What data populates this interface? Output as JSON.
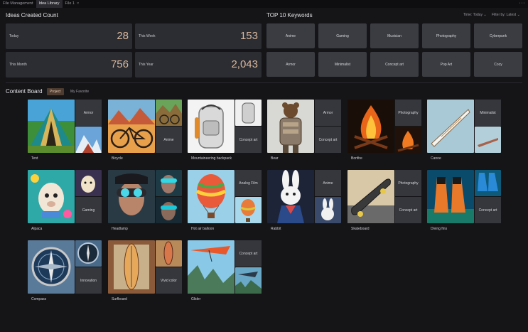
{
  "tabs": [
    {
      "label": "File Management",
      "active": false
    },
    {
      "label": "Idea Library",
      "active": true
    },
    {
      "label": "File 1",
      "active": false,
      "close": "×"
    }
  ],
  "window_menu": "···",
  "ideas": {
    "title": "Ideas Created Count",
    "stats": [
      {
        "label": "Today",
        "value": "28"
      },
      {
        "label": "This Week",
        "value": "153"
      },
      {
        "label": "This Month",
        "value": "756"
      },
      {
        "label": "This Year",
        "value": "2,043"
      }
    ]
  },
  "keywords": {
    "title": "TOP 10 Keywords",
    "time_filter": "Time: Today",
    "sort_filter": "Filter by: Latest",
    "chevron": "⌄",
    "items": [
      "Anime",
      "Gaming",
      "Musician",
      "Photography",
      "Cyberpunk",
      "Armor",
      "Minimalist",
      "Concept art",
      "Pop Art",
      "Cozy"
    ]
  },
  "content_board": {
    "title": "Content Board",
    "tabs": [
      {
        "label": "Project",
        "active": true
      },
      {
        "label": "My Favorite",
        "active": false
      }
    ],
    "cards": [
      {
        "name": "Tent",
        "top_label": "Armor",
        "bottom_label": ""
      },
      {
        "name": "Bicycle",
        "top_label": "",
        "bottom_label": "Anime"
      },
      {
        "name": "Mountaineering backpack",
        "top_label": "",
        "bottom_label": "Concept art"
      },
      {
        "name": "Bear",
        "top_label": "Armor",
        "bottom_label": "Concept art"
      },
      {
        "name": "Bonfire",
        "top_label": "Photography",
        "bottom_label": ""
      },
      {
        "name": "Canoe",
        "top_label": "Minimalist",
        "bottom_label": ""
      },
      {
        "name": "Alpaca",
        "top_label": "",
        "bottom_label": "Gaming"
      },
      {
        "name": "Headlamp",
        "top_label": "",
        "bottom_label": ""
      },
      {
        "name": "Hot air balloon",
        "top_label": "Analog Film",
        "bottom_label": ""
      },
      {
        "name": "Rabbit",
        "top_label": "Anime",
        "bottom_label": ""
      },
      {
        "name": "Skateboard",
        "top_label": "Photography",
        "bottom_label": "Concept art"
      },
      {
        "name": "Diving fins",
        "top_label": "",
        "bottom_label": "Concept art"
      },
      {
        "name": "Compass",
        "top_label": "",
        "bottom_label": "Innovation"
      },
      {
        "name": "Surfboard",
        "top_label": "",
        "bottom_label": "Vivid color"
      },
      {
        "name": "Glider",
        "top_label": "Concept art",
        "bottom_label": ""
      }
    ]
  },
  "colors": {
    "background": "#151518",
    "card": "#2b2d33",
    "keyword_tile": "#3a3c42",
    "accent": "#d9b79c",
    "active_tab": "#4d3c31"
  }
}
